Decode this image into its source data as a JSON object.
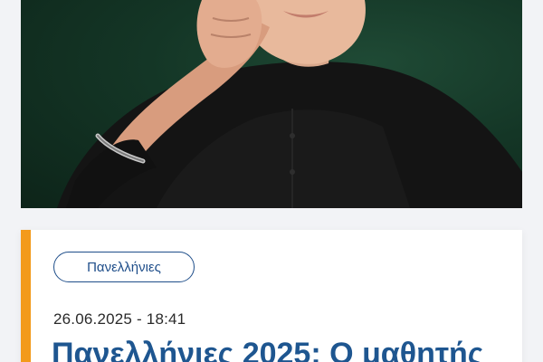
{
  "article": {
    "category": "Πανελλήνιες",
    "date": "26.06.2025 - 18:41",
    "headline": "Πανελλήνιες 2025: Ο μαθητής"
  },
  "colors": {
    "accent": "#f39a1b",
    "headline": "#1e5690",
    "pill_border": "#1f4e8a",
    "hero_background": "#143626"
  },
  "hero": {
    "description_icon": "student-portrait-photo"
  }
}
